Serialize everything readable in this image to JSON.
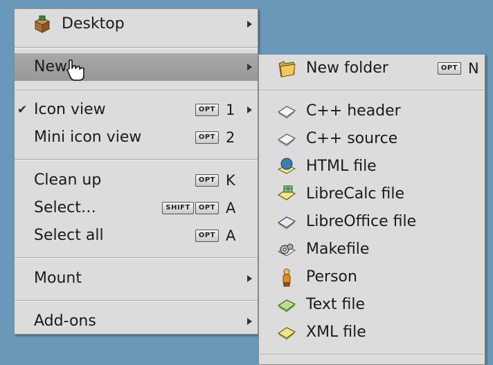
{
  "main_menu": {
    "items": [
      {
        "label": "Desktop",
        "icon": "desktop-box-icon"
      },
      {
        "label": "New"
      },
      {
        "label": "Icon view",
        "checked": true,
        "shortcut_key": "OPT",
        "shortcut_char": "1"
      },
      {
        "label": "Mini icon view",
        "shortcut_key": "OPT",
        "shortcut_char": "2"
      },
      {
        "label": "Clean up",
        "shortcut_key": "OPT",
        "shortcut_char": "K"
      },
      {
        "label": "Select…",
        "shortcut_mod": "SHIFT",
        "shortcut_key": "OPT",
        "shortcut_char": "A"
      },
      {
        "label": "Select all",
        "shortcut_key": "OPT",
        "shortcut_char": "A"
      },
      {
        "label": "Mount"
      },
      {
        "label": "Add-ons"
      }
    ],
    "check_mark": "✔"
  },
  "sub_menu": {
    "items": [
      {
        "label": "New folder",
        "icon": "folder-icon",
        "shortcut_key": "OPT",
        "shortcut_char": "N"
      },
      {
        "label": "C++ header",
        "icon": "cpp-header-file-icon"
      },
      {
        "label": "C++ source",
        "icon": "cpp-source-file-icon"
      },
      {
        "label": "HTML file",
        "icon": "html-file-icon"
      },
      {
        "label": "LibreCalc file",
        "icon": "librecalc-file-icon"
      },
      {
        "label": "LibreOffice file",
        "icon": "libreoffice-file-icon"
      },
      {
        "label": "Makefile",
        "icon": "makefile-icon"
      },
      {
        "label": "Person",
        "icon": "person-icon"
      },
      {
        "label": "Text file",
        "icon": "text-file-icon"
      },
      {
        "label": "XML file",
        "icon": "xml-file-icon"
      }
    ]
  },
  "colors": {
    "desktop": "#6a98b8",
    "menu": "#dcdcdc",
    "highlight": "#a0a0a0"
  }
}
